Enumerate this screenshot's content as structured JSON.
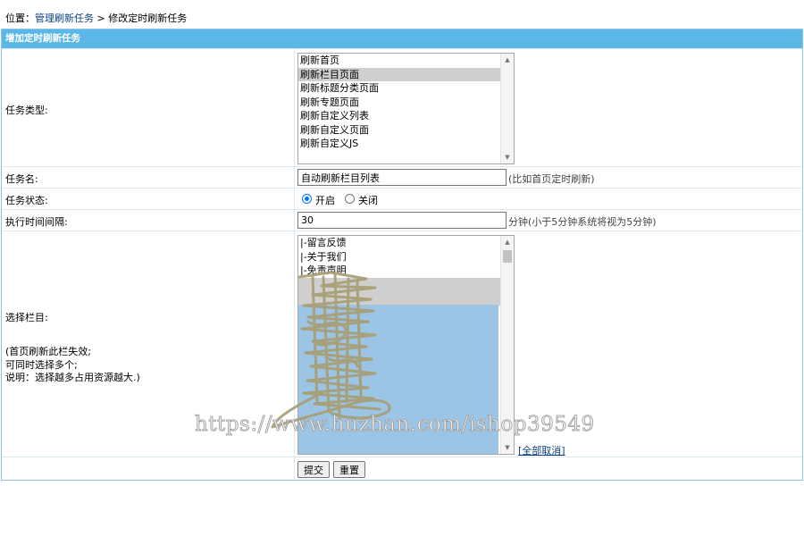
{
  "breadcrumb": {
    "prefix": "位置：",
    "link": "管理刷新任务",
    "separator": " > ",
    "current": "修改定时刷新任务"
  },
  "panel": {
    "title": "增加定时刷新任务"
  },
  "form": {
    "task_type": {
      "label": "任务类型:",
      "options": [
        "刷新首页",
        "刷新栏目页面",
        "刷新标题分类页面",
        "刷新专题页面",
        "刷新自定义列表",
        "刷新自定义页面",
        "刷新自定义JS"
      ],
      "selected": "刷新栏目页面"
    },
    "task_name": {
      "label": "任务名:",
      "value": "自动刷新栏目列表",
      "hint": "(比如首页定时刷新)"
    },
    "task_status": {
      "label": "任务状态:",
      "on_label": "开启",
      "off_label": "关闭",
      "selected": "开启"
    },
    "interval": {
      "label": "执行时间间隔:",
      "value": "30",
      "hint": "分钟(小于5分钟系统将视为5分钟)"
    },
    "columns": {
      "label": "选择栏目:",
      "note_line1": "(首页刷新此栏失效;",
      "note_line2": "可同时选择多个;",
      "note_line3": "说明：选择越多占用资源越大.)",
      "options": [
        "|-留言反馈",
        "|-关于我们",
        "|-免责声明"
      ],
      "cancel_all": "[全部取消]"
    },
    "submit_label": "提交",
    "reset_label": "重置"
  },
  "watermark": "https://www.huzhan.com/ishop39549",
  "colors": {
    "header_bg": "#5bb7e5",
    "link": "#0b3f83",
    "selection": "#cfcfcf",
    "selected_block": "#9cc4e4"
  }
}
